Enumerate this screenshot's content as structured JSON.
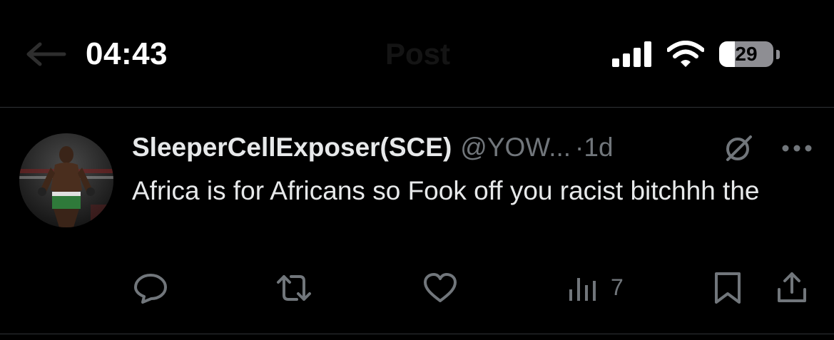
{
  "status_bar": {
    "time": "04:43",
    "battery_level": "29",
    "battery_fraction": 0.29,
    "signal_icon": "cellular-signal-icon",
    "wifi_icon": "wifi-icon"
  },
  "header": {
    "title": "Post",
    "back_icon": "back-arrow-icon"
  },
  "post": {
    "author": {
      "display_name": "SleeperCellExposer(SCE)",
      "handle": "@YOW...",
      "avatar_icon": "avatar"
    },
    "separator": "·",
    "timestamp": "1d",
    "text": "Africa is for Africans so Fook off you racist bitchhh the",
    "grok_icon": "grok-icon",
    "more_icon": "more-options-icon",
    "actions": {
      "reply_icon": "reply-icon",
      "repost_icon": "repost-icon",
      "like_icon": "like-icon",
      "views_icon": "views-icon",
      "views_count": "7",
      "bookmark_icon": "bookmark-icon",
      "share_icon": "share-icon"
    }
  },
  "colors": {
    "background": "#000000",
    "primary_text": "#e7e9ea",
    "secondary_text": "#71767b",
    "divider": "#2f3336",
    "battery_fill": "#ffffff",
    "battery_empty": "#8e8e93"
  }
}
